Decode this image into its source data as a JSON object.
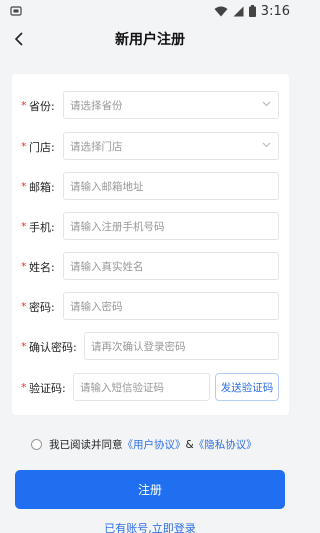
{
  "status_bar": {
    "time": "3:16"
  },
  "header": {
    "title": "新用户注册"
  },
  "form": {
    "province": {
      "label": "省份:",
      "placeholder": "请选择省份"
    },
    "store": {
      "label": "门店:",
      "placeholder": "请选择门店"
    },
    "email": {
      "label": "邮箱:",
      "placeholder": "请输入邮箱地址"
    },
    "phone": {
      "label": "手机:",
      "placeholder": "请输入注册手机号码"
    },
    "name": {
      "label": "姓名:",
      "placeholder": "请输入真实姓名"
    },
    "password": {
      "label": "密码:",
      "placeholder": "请输入密码"
    },
    "confirm_password": {
      "label": "确认密码:",
      "placeholder": "请再次确认登录密码"
    },
    "verify_code": {
      "label": "验证码:",
      "placeholder": "请输入短信验证码",
      "send_button": "发送验证码"
    },
    "required_mark": "*"
  },
  "agreement": {
    "prefix": "我已阅读并同意",
    "user_agreement": "《用户协议》",
    "connector": "&",
    "privacy_agreement": "《隐私协议》"
  },
  "actions": {
    "register_label": "注册",
    "login_link": "已有账号,立即登录"
  },
  "colors": {
    "primary": "#1f6ff0",
    "link": "#2f6fe8",
    "required": "#e33333",
    "background": "#f3f4f6"
  }
}
